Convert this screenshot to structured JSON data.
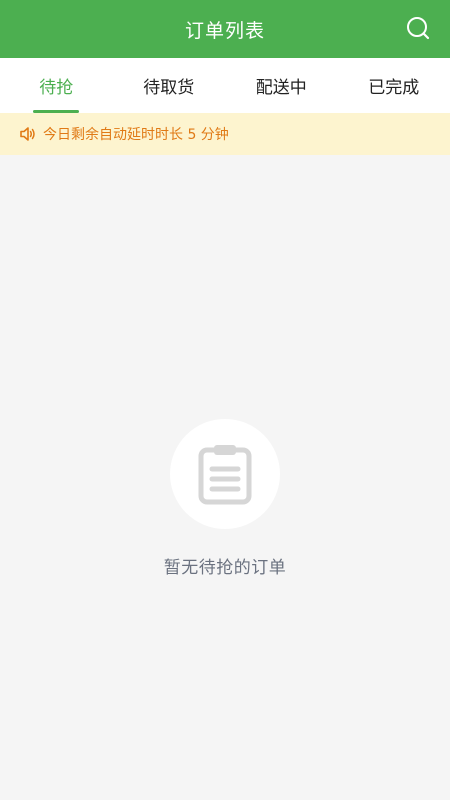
{
  "header": {
    "title": "订单列表",
    "search_icon": "search-icon"
  },
  "tabs": [
    {
      "label": "待抢",
      "active": true
    },
    {
      "label": "待取货",
      "active": false
    },
    {
      "label": "配送中",
      "active": false
    },
    {
      "label": "已完成",
      "active": false
    }
  ],
  "notice": {
    "icon": "speaker-icon",
    "text": "今日剩余自动延时时长 5 分钟"
  },
  "empty_state": {
    "icon": "clipboard-icon",
    "text": "暂无待抢的订单"
  },
  "colors": {
    "primary": "#4caf50",
    "notice_bg": "#fdf4cf",
    "notice_text": "#e07a16",
    "page_bg": "#f5f5f5",
    "empty_text": "#6b7280"
  }
}
